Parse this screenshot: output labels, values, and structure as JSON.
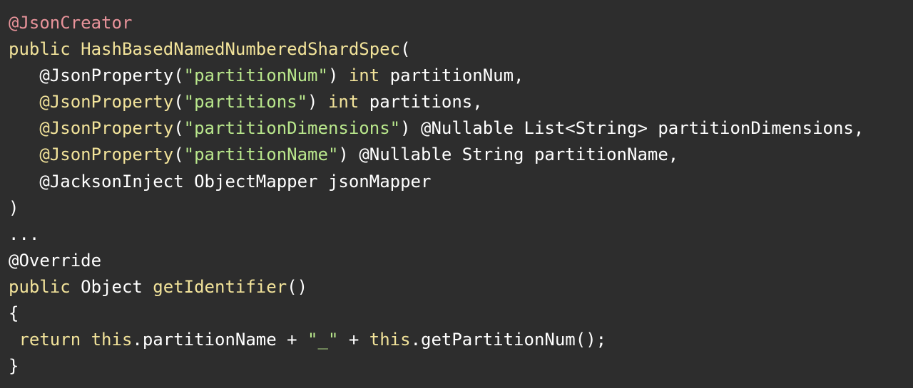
{
  "code": {
    "lines": [
      [
        {
          "text": "@JsonCreator",
          "kind": "annotation-red"
        }
      ],
      [
        {
          "text": "public",
          "kind": "keyword"
        },
        {
          "text": " ",
          "kind": "punct"
        },
        {
          "text": "HashBasedNamedNumberedShardSpec",
          "kind": "funcname"
        },
        {
          "text": "(",
          "kind": "punct"
        }
      ],
      [
        {
          "text": "   ",
          "kind": "punct"
        },
        {
          "text": "@JsonProperty",
          "kind": "annotation-plain"
        },
        {
          "text": "(",
          "kind": "punct"
        },
        {
          "text": "\"partitionNum\"",
          "kind": "string"
        },
        {
          "text": ") ",
          "kind": "punct"
        },
        {
          "text": "int",
          "kind": "keyword"
        },
        {
          "text": " partitionNum,",
          "kind": "ident"
        }
      ],
      [
        {
          "text": "   ",
          "kind": "punct"
        },
        {
          "text": "@JsonProperty",
          "kind": "annotation"
        },
        {
          "text": "(",
          "kind": "punct"
        },
        {
          "text": "\"partitions\"",
          "kind": "string"
        },
        {
          "text": ") ",
          "kind": "punct"
        },
        {
          "text": "int",
          "kind": "keyword"
        },
        {
          "text": " partitions,",
          "kind": "ident"
        }
      ],
      [
        {
          "text": "   ",
          "kind": "punct"
        },
        {
          "text": "@JsonProperty",
          "kind": "annotation"
        },
        {
          "text": "(",
          "kind": "punct"
        },
        {
          "text": "\"partitionDimensions\"",
          "kind": "string"
        },
        {
          "text": ") ",
          "kind": "punct"
        },
        {
          "text": "@Nullable",
          "kind": "annotation-plain"
        },
        {
          "text": " List<String> partitionDimensions,",
          "kind": "ident"
        }
      ],
      [
        {
          "text": "   ",
          "kind": "punct"
        },
        {
          "text": "@JsonProperty",
          "kind": "annotation"
        },
        {
          "text": "(",
          "kind": "punct"
        },
        {
          "text": "\"partitionName\"",
          "kind": "string"
        },
        {
          "text": ") ",
          "kind": "punct"
        },
        {
          "text": "@Nullable",
          "kind": "annotation-plain"
        },
        {
          "text": " String partitionName,",
          "kind": "ident"
        }
      ],
      [
        {
          "text": "   ",
          "kind": "punct"
        },
        {
          "text": "@JacksonInject",
          "kind": "annotation-plain"
        },
        {
          "text": " ObjectMapper jsonMapper",
          "kind": "ident"
        }
      ],
      [
        {
          "text": ")",
          "kind": "punct"
        }
      ],
      [
        {
          "text": "...",
          "kind": "punct"
        }
      ],
      [
        {
          "text": "@Override",
          "kind": "annotation-plain"
        }
      ],
      [
        {
          "text": "public",
          "kind": "keyword"
        },
        {
          "text": " Object ",
          "kind": "type"
        },
        {
          "text": "getIdentifier",
          "kind": "funcname"
        },
        {
          "text": "()",
          "kind": "punct"
        }
      ],
      [
        {
          "text": "{",
          "kind": "punct"
        }
      ],
      [
        {
          "text": " ",
          "kind": "punct"
        },
        {
          "text": "return",
          "kind": "keyword"
        },
        {
          "text": " ",
          "kind": "punct"
        },
        {
          "text": "this",
          "kind": "keyword"
        },
        {
          "text": ".partitionName + ",
          "kind": "ident"
        },
        {
          "text": "\"_\"",
          "kind": "string"
        },
        {
          "text": " + ",
          "kind": "punct"
        },
        {
          "text": "this",
          "kind": "keyword"
        },
        {
          "text": ".getPartitionNum();",
          "kind": "ident"
        }
      ],
      [
        {
          "text": "}",
          "kind": "punct"
        }
      ]
    ]
  }
}
